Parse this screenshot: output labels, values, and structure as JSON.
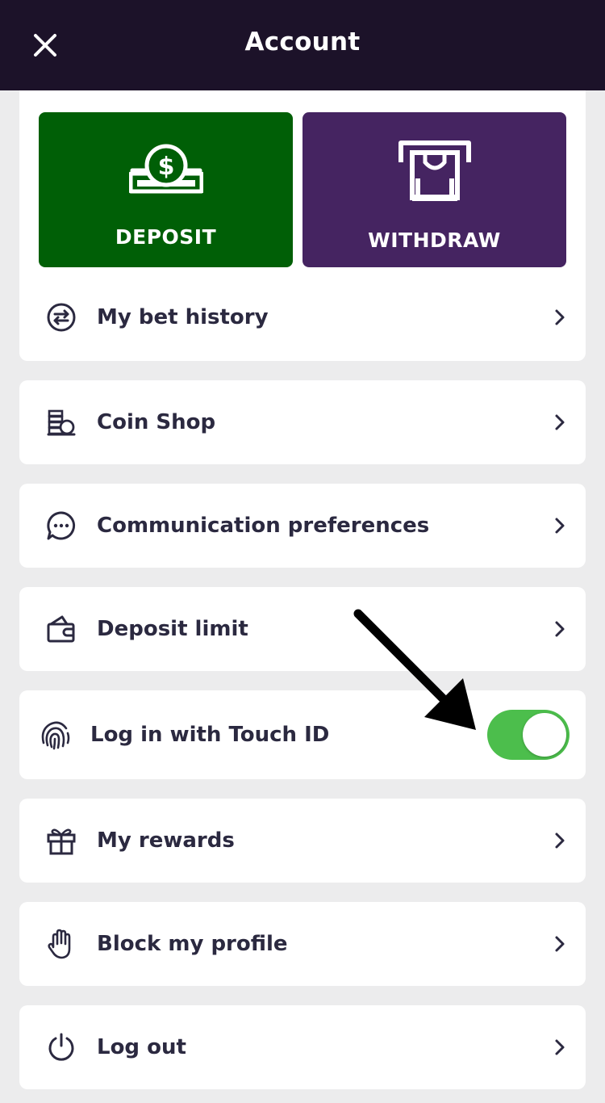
{
  "header": {
    "title": "Account",
    "close_icon": "close-icon"
  },
  "actions": {
    "deposit": {
      "label": "DEPOSIT",
      "icon": "money-bill-icon",
      "color": "#005f06"
    },
    "withdraw": {
      "label": "WITHDRAW",
      "icon": "atm-withdraw-icon",
      "color": "#452461"
    }
  },
  "menu": {
    "bet_history": {
      "label": "My bet history",
      "icon": "swap-arrows-icon"
    },
    "coin_shop": {
      "label": "Coin Shop",
      "icon": "coin-stack-icon"
    },
    "communication": {
      "label": "Communication preferences",
      "icon": "chat-bubble-icon"
    },
    "deposit_limit": {
      "label": "Deposit limit",
      "icon": "wallet-icon"
    },
    "touch_id": {
      "label": "Log in with Touch ID",
      "icon": "fingerprint-icon",
      "enabled": true,
      "toggle_color": "#4cbe4c"
    },
    "rewards": {
      "label": "My rewards",
      "icon": "gift-icon"
    },
    "block_profile": {
      "label": "Block my profile",
      "icon": "hand-stop-icon"
    },
    "log_out": {
      "label": "Log out",
      "icon": "power-icon"
    }
  },
  "colors": {
    "header_bg": "#1c1229",
    "page_bg": "#ececed",
    "text": "#2b2940"
  }
}
